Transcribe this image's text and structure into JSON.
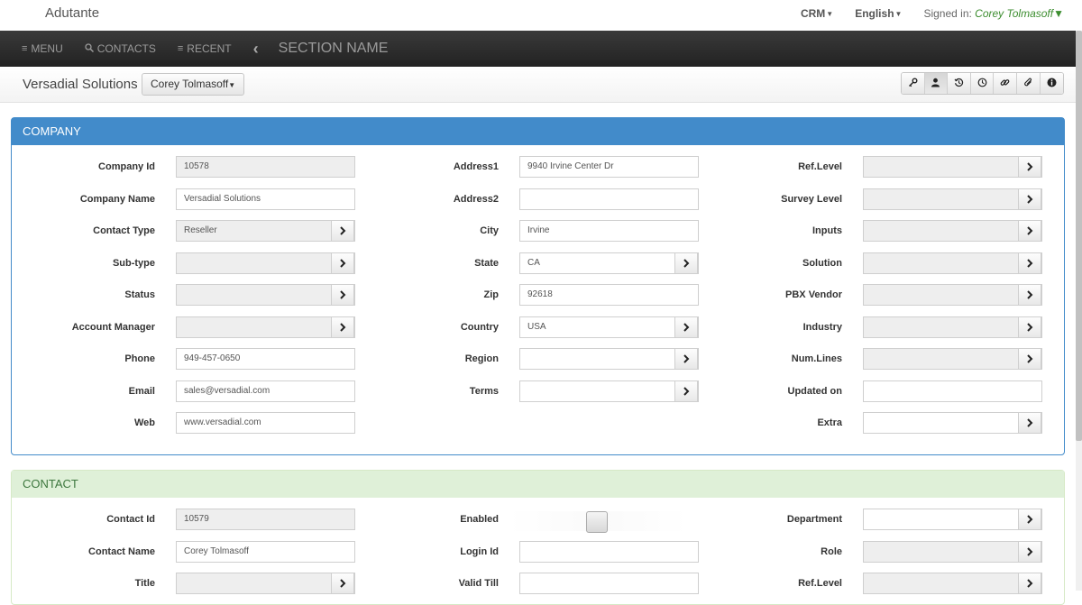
{
  "app": {
    "brand": "Adutante"
  },
  "top": {
    "crm": "CRM",
    "language": "English",
    "signed_label": "Signed in:",
    "user": "Corey Tolmasoff"
  },
  "nav": {
    "menu": "MENU",
    "contacts": "CONTACTS",
    "recent": "RECENT",
    "back": "‹",
    "section": "SECTION NAME"
  },
  "record": {
    "title": "Versadial Solutions",
    "owner": "Corey Tolmasoff",
    "toolbar_icons": [
      "key-icon",
      "user-icon",
      "history-icon",
      "clock-icon",
      "link-icon",
      "paperclip-icon",
      "info-icon"
    ]
  },
  "company": {
    "heading": "COMPANY",
    "col1": [
      {
        "key": "company_id",
        "label": "Company Id",
        "value": "10578",
        "kind": "readonly"
      },
      {
        "key": "company_name",
        "label": "Company Name",
        "value": "Versadial Solutions",
        "kind": "text"
      },
      {
        "key": "contact_type",
        "label": "Contact Type",
        "value": "Reseller",
        "kind": "lookup-ro"
      },
      {
        "key": "sub_type",
        "label": "Sub-type",
        "value": "",
        "kind": "lookup-ro"
      },
      {
        "key": "status",
        "label": "Status",
        "value": "",
        "kind": "lookup-ro"
      },
      {
        "key": "account_manager",
        "label": "Account Manager",
        "value": "",
        "kind": "lookup-ro"
      },
      {
        "key": "phone",
        "label": "Phone",
        "value": "949-457-0650",
        "kind": "text"
      },
      {
        "key": "email",
        "label": "Email",
        "value": "sales@versadial.com",
        "kind": "text"
      },
      {
        "key": "web",
        "label": "Web",
        "value": "www.versadial.com",
        "kind": "text"
      }
    ],
    "col2": [
      {
        "key": "address1",
        "label": "Address1",
        "value": "9940 Irvine Center Dr",
        "kind": "text"
      },
      {
        "key": "address2",
        "label": "Address2",
        "value": "",
        "kind": "text"
      },
      {
        "key": "city",
        "label": "City",
        "value": "Irvine",
        "kind": "text"
      },
      {
        "key": "state",
        "label": "State",
        "value": "CA",
        "kind": "lookup"
      },
      {
        "key": "zip",
        "label": "Zip",
        "value": "92618",
        "kind": "text"
      },
      {
        "key": "country",
        "label": "Country",
        "value": "USA",
        "kind": "lookup"
      },
      {
        "key": "region",
        "label": "Region",
        "value": "",
        "kind": "lookup"
      },
      {
        "key": "terms",
        "label": "Terms",
        "value": "",
        "kind": "lookup"
      }
    ],
    "col3": [
      {
        "key": "ref_level",
        "label": "Ref.Level",
        "value": "",
        "kind": "lookup-ro"
      },
      {
        "key": "survey_level",
        "label": "Survey Level",
        "value": "",
        "kind": "lookup-ro"
      },
      {
        "key": "inputs",
        "label": "Inputs",
        "value": "",
        "kind": "lookup-ro"
      },
      {
        "key": "solution",
        "label": "Solution",
        "value": "",
        "kind": "lookup-ro"
      },
      {
        "key": "pbx_vendor",
        "label": "PBX Vendor",
        "value": "",
        "kind": "lookup-ro"
      },
      {
        "key": "industry",
        "label": "Industry",
        "value": "",
        "kind": "lookup-ro"
      },
      {
        "key": "num_lines",
        "label": "Num.Lines",
        "value": "",
        "kind": "lookup-ro"
      },
      {
        "key": "updated_on",
        "label": "Updated on",
        "value": "",
        "kind": "text"
      },
      {
        "key": "extra",
        "label": "Extra",
        "value": "",
        "kind": "lookup"
      }
    ]
  },
  "contact": {
    "heading": "CONTACT",
    "col1": [
      {
        "key": "contact_id",
        "label": "Contact Id",
        "value": "10579",
        "kind": "readonly"
      },
      {
        "key": "contact_name",
        "label": "Contact Name",
        "value": "Corey Tolmasoff",
        "kind": "text"
      },
      {
        "key": "title",
        "label": "Title",
        "value": "",
        "kind": "lookup-ro"
      }
    ],
    "col2": [
      {
        "key": "enabled",
        "label": "Enabled",
        "value": "",
        "kind": "checkbox"
      },
      {
        "key": "login_id",
        "label": "Login Id",
        "value": "",
        "kind": "text"
      },
      {
        "key": "valid_till",
        "label": "Valid Till",
        "value": "",
        "kind": "text"
      }
    ],
    "col3": [
      {
        "key": "department",
        "label": "Department",
        "value": "",
        "kind": "lookup"
      },
      {
        "key": "role",
        "label": "Role",
        "value": "",
        "kind": "lookup-ro"
      },
      {
        "key": "ref_level",
        "label": "Ref.Level",
        "value": "",
        "kind": "lookup-ro"
      }
    ]
  },
  "icons": {
    "lookup": "chevron-right-icon",
    "menu": "menu-icon",
    "contacts": "search-icon",
    "recent": "list-icon",
    "back": "chevron-left-icon"
  },
  "colors": {
    "company_accent": "#428bca",
    "contact_accent": "#dff0d8",
    "contact_text": "#3c763d",
    "user_green": "#3c8d2f",
    "navbar": "#2b2b2b"
  }
}
